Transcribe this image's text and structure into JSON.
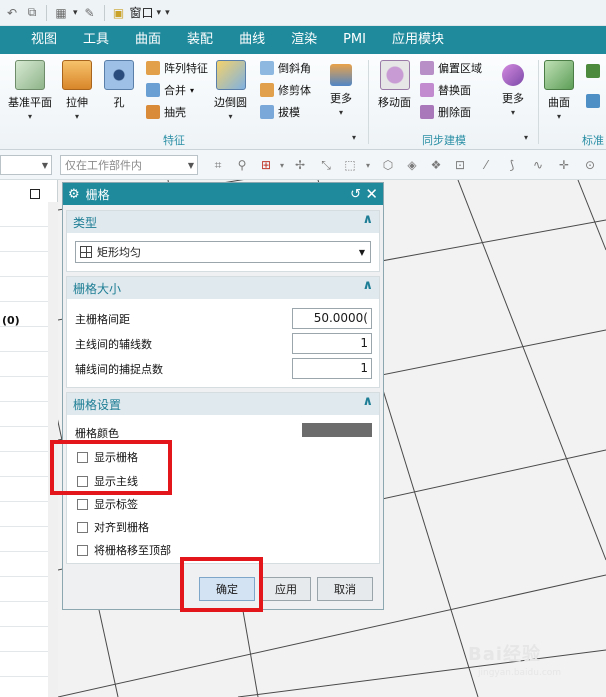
{
  "quick_access": {
    "window_label": "窗口",
    "caret": "▾"
  },
  "ribbon": {
    "tabs": [
      "视图",
      "工具",
      "曲面",
      "装配",
      "曲线",
      "渲染",
      "PMI",
      "应用模块"
    ],
    "big_buttons": {
      "datum_plane": "基准平面",
      "extrude": "拉伸",
      "hole": "孔",
      "edge_blend": "边倒圆",
      "more_feature": "更多",
      "move_face": "移动面",
      "more_sync": "更多",
      "surface": "曲面"
    },
    "small_buttons": {
      "pattern_feature": "阵列特征",
      "unite": "合并",
      "shell": "抽壳",
      "chamfer": "倒斜角",
      "trim_body": "修剪体",
      "draft": "拔模",
      "offset_region": "偏置区域",
      "replace_face": "替换面",
      "delete_face": "删除面"
    },
    "groups": {
      "feature": "特征",
      "sync_modeling": "同步建模",
      "standard": "标准"
    }
  },
  "selection_bar": {
    "scope_combo": "仅在工作部件内"
  },
  "navigator": {
    "partial_text": "(0)"
  },
  "dialog": {
    "title": "栅格",
    "sections": {
      "type": {
        "header": "类型",
        "selected": "矩形均匀"
      },
      "grid_size": {
        "header": "栅格大小",
        "rows": [
          {
            "label": "主栅格间距",
            "value": "50.0000("
          },
          {
            "label": "主线间的辅线数",
            "value": "1"
          },
          {
            "label": "辅线间的捕捉点数",
            "value": "1"
          }
        ]
      },
      "grid_settings": {
        "header": "栅格设置",
        "color_label": "栅格颜色",
        "color_value": "#6c6c6c",
        "checkboxes": [
          {
            "label": "显示栅格",
            "checked": false
          },
          {
            "label": "显示主线",
            "checked": false
          },
          {
            "label": "显示标签",
            "checked": false
          },
          {
            "label": "对齐到栅格",
            "checked": false
          },
          {
            "label": "将栅格移至顶部",
            "checked": false
          }
        ]
      }
    },
    "buttons": {
      "ok": "确定",
      "apply": "应用",
      "cancel": "取消"
    }
  },
  "annotation_color": "#e2161b",
  "watermark": {
    "main": "Bai经验",
    "sub": "jingyan.baidu.com"
  }
}
